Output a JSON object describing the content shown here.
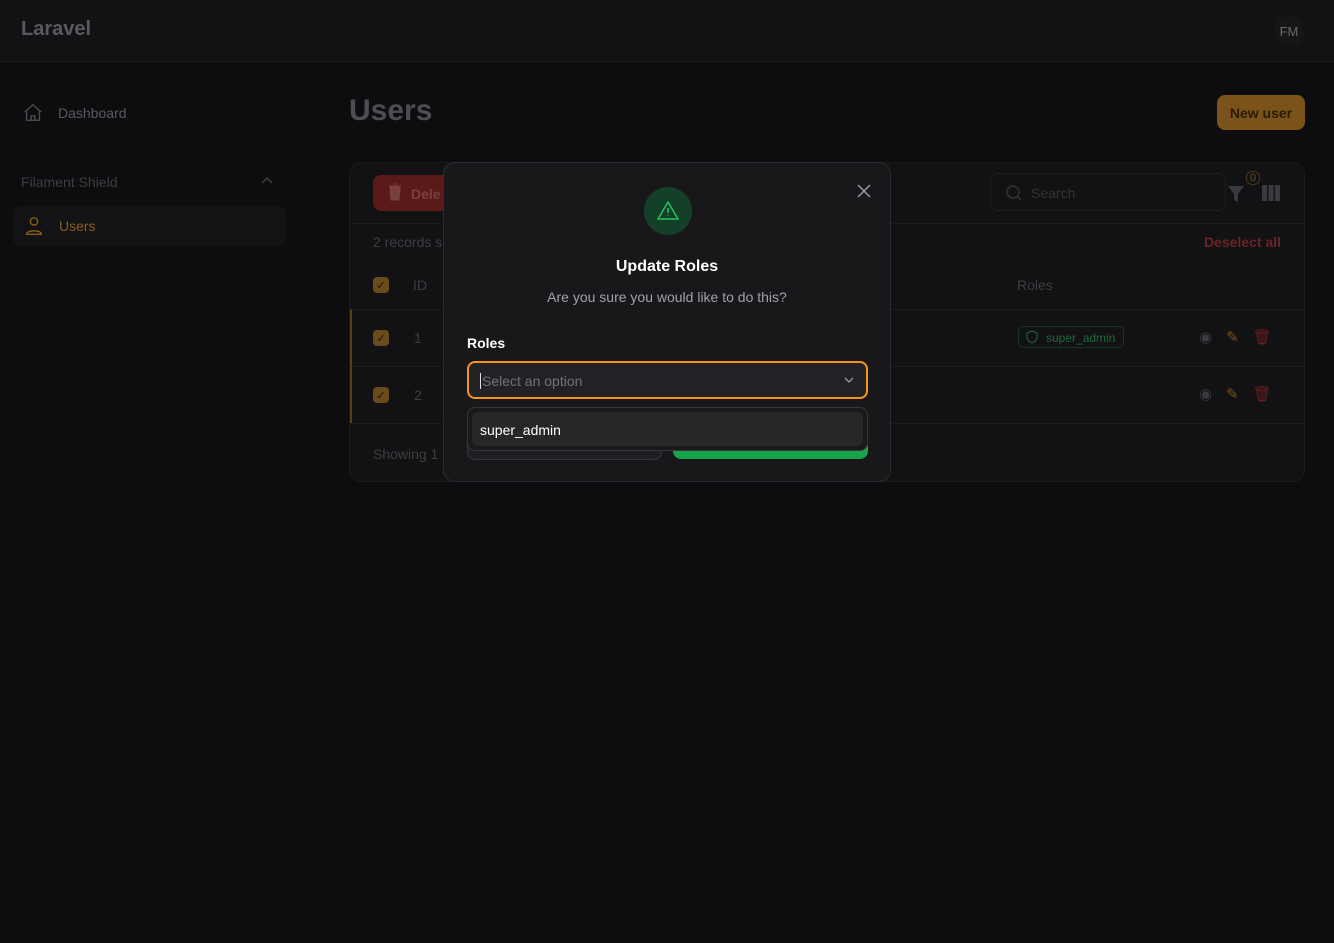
{
  "app": {
    "brand": "Laravel",
    "user_initials": "FM"
  },
  "sidebar": {
    "dashboard": "Dashboard",
    "group": "Filament Shield",
    "users": "Users"
  },
  "page": {
    "title": "Users",
    "new_button": "New user"
  },
  "table": {
    "bulk_delete": "Dele",
    "search_placeholder": "Search",
    "filter_count": "0",
    "selected_text": "2 records s",
    "deselect_all": "Deselect all",
    "headers": {
      "id": "ID",
      "roles": "Roles"
    },
    "rows": [
      {
        "id": "1",
        "role": "super_admin"
      },
      {
        "id": "2",
        "role": ""
      }
    ],
    "footer": "Showing 1"
  },
  "modal": {
    "title": "Update Roles",
    "subtitle": "Are you sure you would like to do this?",
    "field_label": "Roles",
    "placeholder": "Select an option",
    "options": [
      "super_admin"
    ],
    "colors": {
      "accent": "#f59e0b",
      "success": "#22c55e",
      "danger": "#ef4444"
    }
  }
}
